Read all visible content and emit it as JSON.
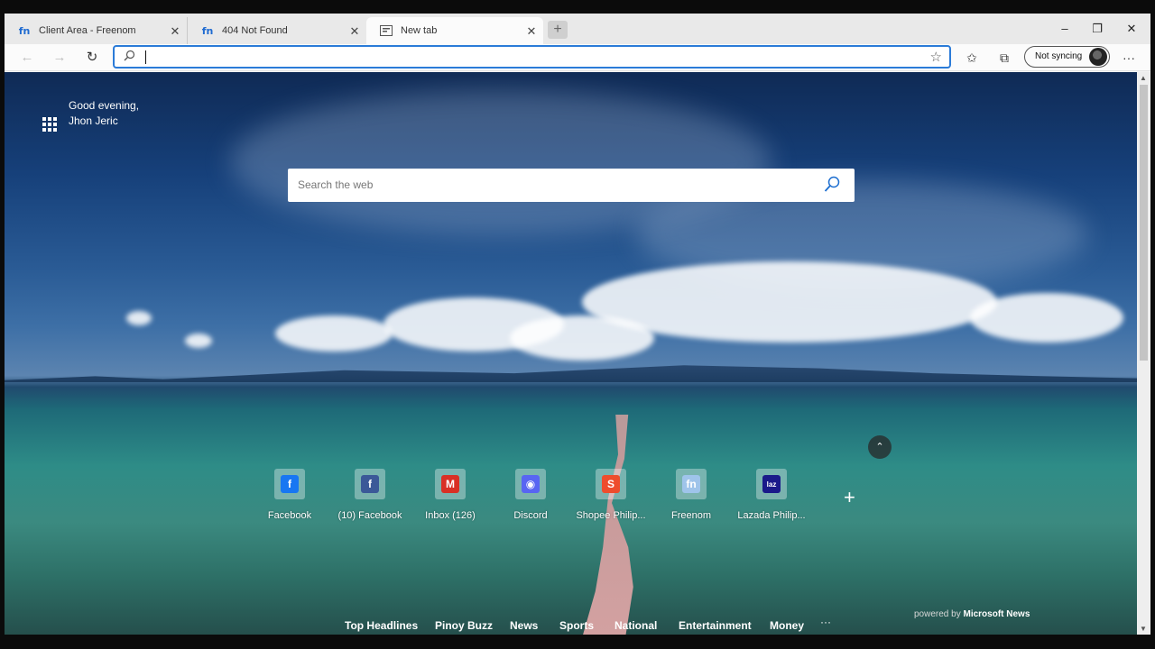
{
  "browser": {
    "tabs": [
      {
        "title": "Client Area - Freenom",
        "icon": "freenom-icon",
        "fav": "fn"
      },
      {
        "title": "404 Not Found",
        "icon": "freenom-icon",
        "fav": "fn"
      },
      {
        "title": "New tab",
        "icon": "new-tab-icon",
        "fav": "",
        "active": true
      }
    ],
    "new_tab_symbol": "+",
    "window_controls": {
      "minimize": "–",
      "restore": "❐",
      "close": "✕"
    },
    "address_bar": {
      "value": "",
      "placeholder": ""
    },
    "sync_label": "Not syncing"
  },
  "newtab": {
    "greeting_line1": "Good evening,",
    "greeting_line2": "Jhon Jeric",
    "search_placeholder": "Search the web",
    "quick_links": [
      {
        "label": "Facebook",
        "icon": "facebook-icon",
        "color": "#1877f2",
        "glyph": "f"
      },
      {
        "label": "(10) Facebook",
        "icon": "facebook-icon",
        "color": "#3b5998",
        "glyph": "f"
      },
      {
        "label": "Inbox (126)",
        "icon": "gmail-icon",
        "color": "#d93025",
        "glyph": "M"
      },
      {
        "label": "Discord",
        "icon": "discord-icon",
        "color": "#5865f2",
        "glyph": "◉"
      },
      {
        "label": "Shopee Philip...",
        "icon": "shopee-icon",
        "color": "#ee4d2d",
        "glyph": "S"
      },
      {
        "label": "Freenom",
        "icon": "freenom-icon",
        "color": "#9fc4ea",
        "glyph": "fn"
      },
      {
        "label": "Lazada Philip...",
        "icon": "lazada-icon",
        "color": "#1a1a8a",
        "glyph": "laz"
      }
    ],
    "powered_by_prefix": "powered by",
    "powered_by_brand": "Microsoft News",
    "news_categories": [
      "Top Headlines",
      "Pinoy Buzz",
      "News",
      "Sports",
      "National",
      "Entertainment",
      "Money"
    ],
    "news_more": "···"
  }
}
